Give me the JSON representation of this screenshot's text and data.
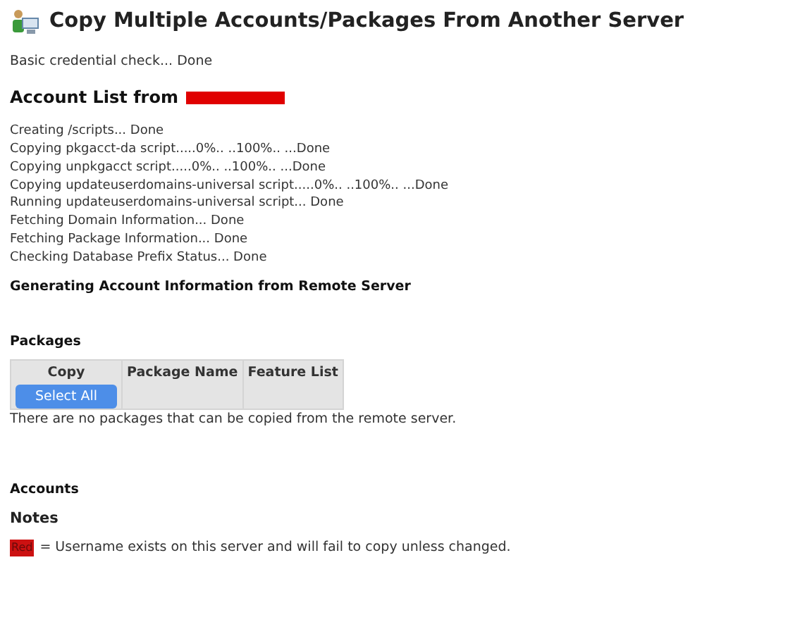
{
  "title": "Copy Multiple Accounts/Packages From Another Server",
  "credential_check": "Basic credential check... Done",
  "account_list_heading": "Account List from",
  "log": [
    "Creating /scripts... Done",
    "Copying pkgacct-da script.....0%.. ..100%.. ...Done",
    "Copying unpkgacct script.....0%.. ..100%.. ...Done",
    "Copying updateuserdomains-universal script.....0%.. ..100%.. ...Done",
    "Running updateuserdomains-universal script... Done",
    "Fetching Domain Information... Done",
    "Fetching Package Information... Done",
    "Checking Database Prefix Status... Done"
  ],
  "generating": "Generating Account Information from Remote Server",
  "packages": {
    "heading": "Packages",
    "columns": [
      "Copy",
      "Package Name",
      "Feature List"
    ],
    "select_all": "Select All",
    "empty_message": "There are no packages that can be copied from the remote server."
  },
  "accounts_heading": "Accounts",
  "notes": {
    "heading": "Notes",
    "swatch_label": "Red",
    "text": "= Username exists on this server and will fail to copy unless changed."
  }
}
